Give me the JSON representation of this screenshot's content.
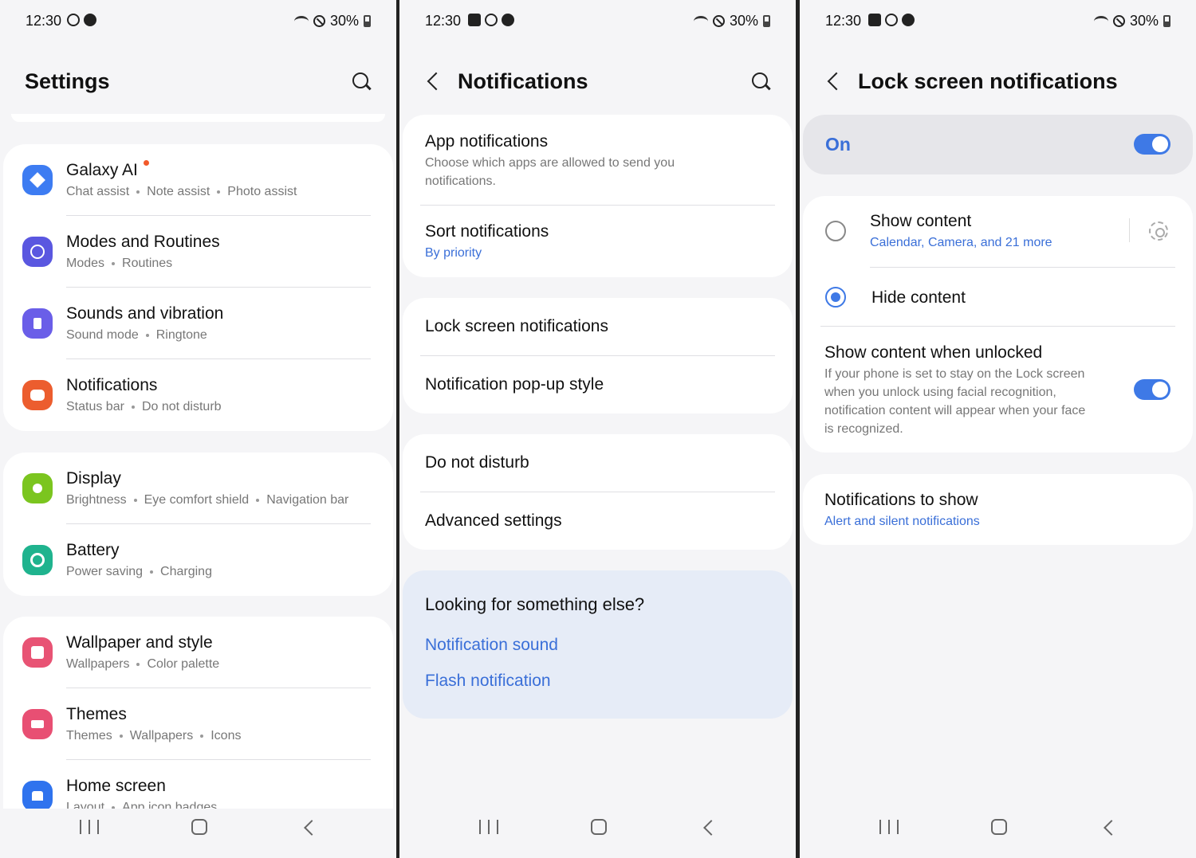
{
  "status": {
    "time": "12:30",
    "battery": "30%"
  },
  "settings": {
    "title": "Settings",
    "items": [
      {
        "title": "Galaxy AI",
        "subs": [
          "Chat assist",
          "Note assist",
          "Photo assist"
        ],
        "icon": "sparkle-icon",
        "color": "#3d7cf2"
      },
      {
        "title": "Modes and Routines",
        "subs": [
          "Modes",
          "Routines"
        ],
        "icon": "check-circle-icon",
        "color": "#5a57e0"
      },
      {
        "title": "Sounds and vibration",
        "subs": [
          "Sound mode",
          "Ringtone"
        ],
        "icon": "speaker-icon",
        "color": "#6a5ee8"
      },
      {
        "title": "Notifications",
        "subs": [
          "Status bar",
          "Do not disturb"
        ],
        "icon": "notification-icon",
        "color": "#ec5d2e"
      },
      {
        "title": "Display",
        "subs": [
          "Brightness",
          "Eye comfort shield",
          "Navigation bar"
        ],
        "icon": "sun-icon",
        "color": "#7bc51f"
      },
      {
        "title": "Battery",
        "subs": [
          "Power saving",
          "Charging"
        ],
        "icon": "battery-icon",
        "color": "#1fb38e"
      },
      {
        "title": "Wallpaper and style",
        "subs": [
          "Wallpapers",
          "Color palette"
        ],
        "icon": "image-icon",
        "color": "#e85374"
      },
      {
        "title": "Themes",
        "subs": [
          "Themes",
          "Wallpapers",
          "Icons"
        ],
        "icon": "brush-icon",
        "color": "#e84f73"
      },
      {
        "title": "Home screen",
        "subs": [
          "Layout",
          "App icon badges"
        ],
        "icon": "home-icon",
        "color": "#2f73ee"
      }
    ]
  },
  "notifications": {
    "title": "Notifications",
    "app_notifications": {
      "title": "App notifications",
      "desc_line1": "Choose which apps are allowed to send you",
      "desc_line2": "notifications."
    },
    "sort_notifications": {
      "title": "Sort notifications",
      "value": "By priority"
    },
    "lock_screen": "Lock screen notifications",
    "popup_style": "Notification pop-up style",
    "do_not_disturb": "Do not disturb",
    "advanced": "Advanced settings",
    "looking": {
      "title": "Looking for something else?",
      "link1": "Notification sound",
      "link2": "Flash notification"
    }
  },
  "lockscreen": {
    "title": "Lock screen notifications",
    "master_label": "On",
    "show_content": {
      "title": "Show content",
      "sub": "Calendar, Camera, and 21 more"
    },
    "hide_content": "Hide content",
    "unlocked": {
      "title": "Show content when unlocked",
      "line1": "If your phone is set to stay on the Lock screen",
      "line2": "when you unlock using facial recognition,",
      "line3": "notification content will appear when your face",
      "line4": "is recognized."
    },
    "to_show": {
      "title": "Notifications to show",
      "value": "Alert and silent notifications"
    }
  },
  "colors": {
    "accent": "#3e79e6",
    "link": "#3a6fd8",
    "bg": "#f5f5f7",
    "highlight_card": "#e6ecf7"
  }
}
